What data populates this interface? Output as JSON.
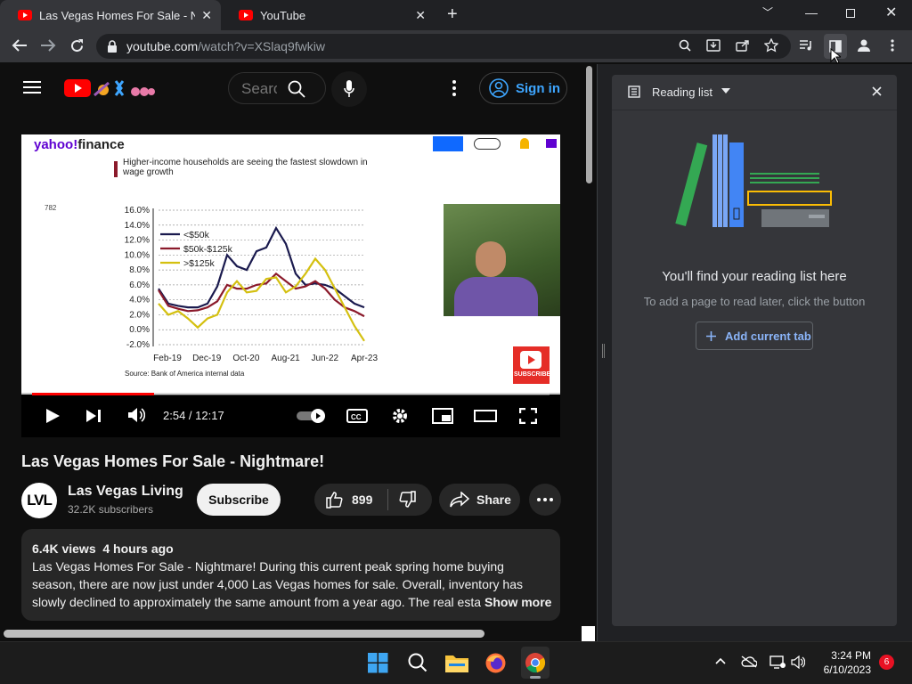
{
  "browser": {
    "tabs": [
      {
        "label": "Las Vegas Homes For Sale - Nightmare! - YouTube"
      },
      {
        "label": "YouTube"
      }
    ],
    "url_host": "youtube.com",
    "url_path": "/watch?v=XSlaq9fwkiw"
  },
  "youtube": {
    "search_placeholder": "Search",
    "sign_in_label": "Sign in"
  },
  "video": {
    "chart_banner_text": "Higher-income households are seeing the fastest slowdown in wage growth",
    "current_time": "2:54 / 12:17",
    "progress_fraction": 0.236,
    "embed_subscribe": "SUBSCRIBE",
    "chart_source": "Source: Bank of America internal data",
    "comment_count": "782",
    "title": "Las Vegas Homes For Sale - Nightmare!",
    "channel_initials": "LVL",
    "channel_name": "Las Vegas Living",
    "subscribers": "32.2K subscribers",
    "subscribe_label": "Subscribe",
    "likes": "899",
    "share_label": "Share",
    "views_time": "6.4K views  4 hours ago",
    "description": "Las Vegas Homes For Sale - Nightmare! During this current peak spring home buying season, there are now just under 4,000 Las Vegas homes for sale. Overall, inventory has slowly declined to approximately the same amount from a year ago. The real estate market",
    "show_more": "Show more"
  },
  "chart_data": {
    "type": "line",
    "x": [
      "Feb-19",
      "Dec-19",
      "Oct-20",
      "Aug-21",
      "Jun-22",
      "Apr-23"
    ],
    "yticks": [
      "16.0%",
      "14.0%",
      "12.0%",
      "10.0%",
      "8.0%",
      "6.0%",
      "4.0%",
      "2.0%",
      "0.0%",
      "-2.0%"
    ],
    "ylim": [
      -2,
      16
    ],
    "legend": [
      "<$50k",
      "$50k-$125k",
      ">$125k"
    ],
    "colors": [
      "#1a1a4e",
      "#8b1a2b",
      "#d4c010"
    ],
    "series": [
      {
        "name": "<$50k",
        "values": [
          5.5,
          3.5,
          3.2,
          3.0,
          3.0,
          3.5,
          5.8,
          10.0,
          8.5,
          8.0,
          10.5,
          11.0,
          13.6,
          11.5,
          7.5,
          6.0,
          6.2,
          6.0,
          5.5,
          4.5,
          3.5,
          3.0
        ]
      },
      {
        "name": "$50k-$125k",
        "values": [
          5.3,
          3.2,
          2.8,
          2.5,
          2.6,
          3.0,
          3.8,
          6.0,
          5.5,
          5.5,
          6.0,
          6.2,
          7.5,
          6.5,
          5.5,
          5.8,
          6.5,
          5.5,
          4.0,
          3.0,
          2.5,
          1.8
        ]
      },
      {
        "name": ">$125k",
        "values": [
          3.5,
          2.0,
          2.5,
          1.5,
          0.3,
          1.5,
          2.0,
          5.0,
          6.5,
          5.0,
          5.2,
          6.8,
          7.0,
          5.0,
          5.8,
          7.5,
          9.5,
          8.0,
          5.5,
          3.0,
          0.5,
          -1.5
        ]
      }
    ]
  },
  "reading_list": {
    "title": "Reading list",
    "empty_title": "You'll find your reading list here",
    "hint": "To add a page to read later, click the button",
    "add_label": "Add current tab"
  },
  "taskbar": {
    "time": "3:24 PM",
    "date": "6/10/2023",
    "notifications": "6"
  }
}
